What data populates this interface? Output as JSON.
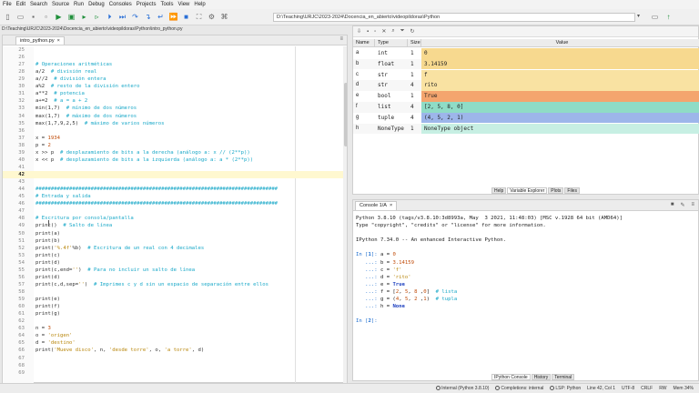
{
  "menu": [
    "File",
    "Edit",
    "Search",
    "Source",
    "Run",
    "Debug",
    "Consoles",
    "Projects",
    "Tools",
    "View",
    "Help"
  ],
  "toolbar": {
    "path": "D:\\Teaching\\URJC\\2023-2024\\Docencia_en_abierto\\videopildoras\\Python",
    "path_select": "▾"
  },
  "editor": {
    "file_path": "D:\\Teaching\\URJC\\2023-2024\\Docencia_en_abierto\\videopildoras\\Python\\intro_python.py",
    "tab": "intro_python.py",
    "tab_close": "×",
    "lines": [
      {
        "n": "25",
        "parts": []
      },
      {
        "n": "26",
        "parts": []
      },
      {
        "n": "27",
        "parts": [
          {
            "t": "# Operaciones aritméticas",
            "c": "c"
          }
        ]
      },
      {
        "n": "28",
        "parts": [
          {
            "t": "a/2  ",
            "c": "t"
          },
          {
            "t": "# división real",
            "c": "c"
          }
        ]
      },
      {
        "n": "29",
        "parts": [
          {
            "t": "a//2  ",
            "c": "t"
          },
          {
            "t": "# división entera",
            "c": "c"
          }
        ]
      },
      {
        "n": "30",
        "parts": [
          {
            "t": "a%2  ",
            "c": "t"
          },
          {
            "t": "# resto de la división entero",
            "c": "c"
          }
        ]
      },
      {
        "n": "31",
        "parts": [
          {
            "t": "a**2  ",
            "c": "t"
          },
          {
            "t": "# potencia",
            "c": "c"
          }
        ]
      },
      {
        "n": "32",
        "parts": [
          {
            "t": "a+=2  ",
            "c": "t"
          },
          {
            "t": "# a = a + 2",
            "c": "c"
          }
        ]
      },
      {
        "n": "33",
        "parts": [
          {
            "t": "min(1,7)  ",
            "c": "t"
          },
          {
            "t": "# mínimo de dos números",
            "c": "c"
          }
        ]
      },
      {
        "n": "34",
        "parts": [
          {
            "t": "max(1,7)  ",
            "c": "t"
          },
          {
            "t": "# máximo de dos números",
            "c": "c"
          }
        ]
      },
      {
        "n": "35",
        "parts": [
          {
            "t": "max(1,7,9,2,5)  ",
            "c": "t"
          },
          {
            "t": "# máximo de varios números",
            "c": "c"
          }
        ]
      },
      {
        "n": "36",
        "parts": []
      },
      {
        "n": "37",
        "parts": [
          {
            "t": "x = ",
            "c": "t"
          },
          {
            "t": "1934",
            "c": "n"
          }
        ]
      },
      {
        "n": "38",
        "parts": [
          {
            "t": "p = ",
            "c": "t"
          },
          {
            "t": "2",
            "c": "n"
          }
        ]
      },
      {
        "n": "39",
        "parts": [
          {
            "t": "x >> p  ",
            "c": "t"
          },
          {
            "t": "# desplazamiento de bits a la derecha (análogo a: x // (2**p))",
            "c": "c"
          }
        ]
      },
      {
        "n": "40",
        "parts": [
          {
            "t": "x << p  ",
            "c": "t"
          },
          {
            "t": "# desplazamiento de bits a la izquierda (análogo a: a * (2**p))",
            "c": "c"
          }
        ]
      },
      {
        "n": "41",
        "parts": []
      },
      {
        "n": "42",
        "parts": [],
        "cur": true
      },
      {
        "n": "43",
        "parts": []
      },
      {
        "n": "44",
        "parts": [
          {
            "t": "###############################################################################",
            "c": "c"
          }
        ]
      },
      {
        "n": "45",
        "parts": [
          {
            "t": "# Entrada y salida",
            "c": "c"
          }
        ]
      },
      {
        "n": "46",
        "parts": [
          {
            "t": "###############################################################################",
            "c": "c"
          }
        ]
      },
      {
        "n": "47",
        "parts": []
      },
      {
        "n": "48",
        "parts": [
          {
            "t": "# Escritura por consola/pantalla",
            "c": "c"
          }
        ]
      },
      {
        "n": "49",
        "parts": [
          {
            "t": "print()  ",
            "c": "t"
          },
          {
            "t": "# Salto de línea",
            "c": "c"
          }
        ]
      },
      {
        "n": "50",
        "parts": [
          {
            "t": "print(a)",
            "c": "t"
          }
        ]
      },
      {
        "n": "51",
        "parts": [
          {
            "t": "print(b)",
            "c": "t"
          }
        ]
      },
      {
        "n": "52",
        "parts": [
          {
            "t": "print(",
            "c": "t"
          },
          {
            "t": "'%.4f'",
            "c": "s"
          },
          {
            "t": "%b)  ",
            "c": "t"
          },
          {
            "t": "# Escritura de un real con 4 decimales",
            "c": "c"
          }
        ]
      },
      {
        "n": "53",
        "parts": [
          {
            "t": "print(c)",
            "c": "t"
          }
        ]
      },
      {
        "n": "54",
        "parts": [
          {
            "t": "print(d)",
            "c": "t"
          }
        ]
      },
      {
        "n": "55",
        "parts": [
          {
            "t": "print(c,end=",
            "c": "t"
          },
          {
            "t": "''",
            "c": "s"
          },
          {
            "t": ")  ",
            "c": "t"
          },
          {
            "t": "# Para no incluir un salto de línea",
            "c": "c"
          }
        ]
      },
      {
        "n": "56",
        "parts": [
          {
            "t": "print(d)",
            "c": "t"
          }
        ]
      },
      {
        "n": "57",
        "parts": [
          {
            "t": "print(c,d,sep=",
            "c": "t"
          },
          {
            "t": "''",
            "c": "s"
          },
          {
            "t": ")  ",
            "c": "t"
          },
          {
            "t": "# Imprimes c y d sin un espacio de separación entre ellos",
            "c": "c"
          }
        ]
      },
      {
        "n": "58",
        "parts": []
      },
      {
        "n": "59",
        "parts": [
          {
            "t": "print(e)",
            "c": "t"
          }
        ]
      },
      {
        "n": "60",
        "parts": [
          {
            "t": "print(f)",
            "c": "t"
          }
        ]
      },
      {
        "n": "61",
        "parts": [
          {
            "t": "print(g)",
            "c": "t"
          }
        ]
      },
      {
        "n": "62",
        "parts": []
      },
      {
        "n": "63",
        "parts": [
          {
            "t": "n = ",
            "c": "t"
          },
          {
            "t": "3",
            "c": "n"
          }
        ]
      },
      {
        "n": "64",
        "parts": [
          {
            "t": "o = ",
            "c": "t"
          },
          {
            "t": "'origen'",
            "c": "s"
          }
        ]
      },
      {
        "n": "65",
        "parts": [
          {
            "t": "d = ",
            "c": "t"
          },
          {
            "t": "'destino'",
            "c": "s"
          }
        ]
      },
      {
        "n": "66",
        "parts": [
          {
            "t": "print(",
            "c": "t"
          },
          {
            "t": "'Mueve disco'",
            "c": "s"
          },
          {
            "t": ", n, ",
            "c": "t"
          },
          {
            "t": "'desde torre'",
            "c": "s"
          },
          {
            "t": ", o, ",
            "c": "t"
          },
          {
            "t": "'a torre'",
            "c": "s"
          },
          {
            "t": ", d)",
            "c": "t"
          }
        ]
      },
      {
        "n": "67",
        "parts": []
      },
      {
        "n": "68",
        "parts": []
      },
      {
        "n": "69",
        "parts": []
      }
    ]
  },
  "varexp": {
    "headers": [
      "Name",
      "Type",
      "Size",
      "Value"
    ],
    "rows": [
      {
        "name": "a",
        "type": "int",
        "size": "1",
        "value": "0",
        "color": "#f7d98f"
      },
      {
        "name": "b",
        "type": "float",
        "size": "1",
        "value": "3.14159",
        "color": "#f7d98f"
      },
      {
        "name": "c",
        "type": "str",
        "size": "1",
        "value": "f",
        "color": "#f9e2a2"
      },
      {
        "name": "d",
        "type": "str",
        "size": "4",
        "value": "rito",
        "color": "#f9e2a2"
      },
      {
        "name": "e",
        "type": "bool",
        "size": "1",
        "value": "True",
        "color": "#f4a56e"
      },
      {
        "name": "f",
        "type": "list",
        "size": "4",
        "value": "[2, 5, 8, 0]",
        "color": "#8fdcc6"
      },
      {
        "name": "g",
        "type": "tuple",
        "size": "4",
        "value": "(4, 5, 2, 1)",
        "color": "#9db6ea"
      },
      {
        "name": "h",
        "type": "NoneType",
        "size": "1",
        "value": "NoneType object",
        "color": "#c7efe3"
      }
    ],
    "bottom_tabs": [
      "Help",
      "Variable Explorer",
      "Plots",
      "Files"
    ]
  },
  "console": {
    "tab": "Console 1/A",
    "tab_close": "×",
    "bottom_tabs": [
      "IPython Console",
      "History",
      "Terminal"
    ]
  },
  "status": [
    "Internal (Python 3.8.10)",
    "Completions: internal",
    "LSP: Python",
    "Line 42, Col 1",
    "UTF-8",
    "CRLF",
    "RW",
    "Mem 34%"
  ]
}
